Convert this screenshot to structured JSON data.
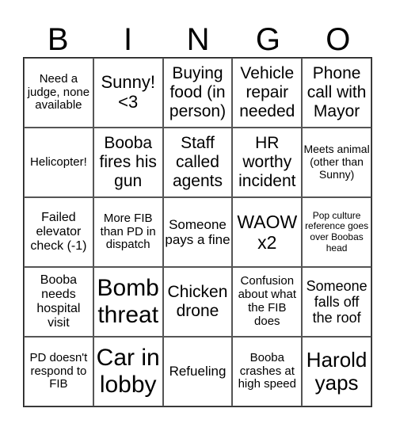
{
  "header": [
    "B",
    "I",
    "N",
    "G",
    "O"
  ],
  "cells": [
    "Need a judge, none available",
    "Sunny! <3",
    "Buying food (in person)",
    "Vehicle repair needed",
    "Phone call with Mayor",
    "Helicopter!",
    "Booba fires his gun",
    "Staff called agents",
    "HR worthy incident",
    "Meets animal (other than Sunny)",
    "Failed elevator check (-1)",
    "More FIB than PD in dispatch",
    "Someone pays a fine",
    "WAOW x2",
    "Pop culture reference goes over Boobas head",
    "Booba needs hospital visit",
    "Bomb threat",
    "Chicken drone",
    "Confusion about what the FIB does",
    "Someone falls off the roof",
    "PD doesn't respond to FIB",
    "Car in lobby",
    "Refueling",
    "Booba crashes at high speed",
    "Harold yaps"
  ]
}
